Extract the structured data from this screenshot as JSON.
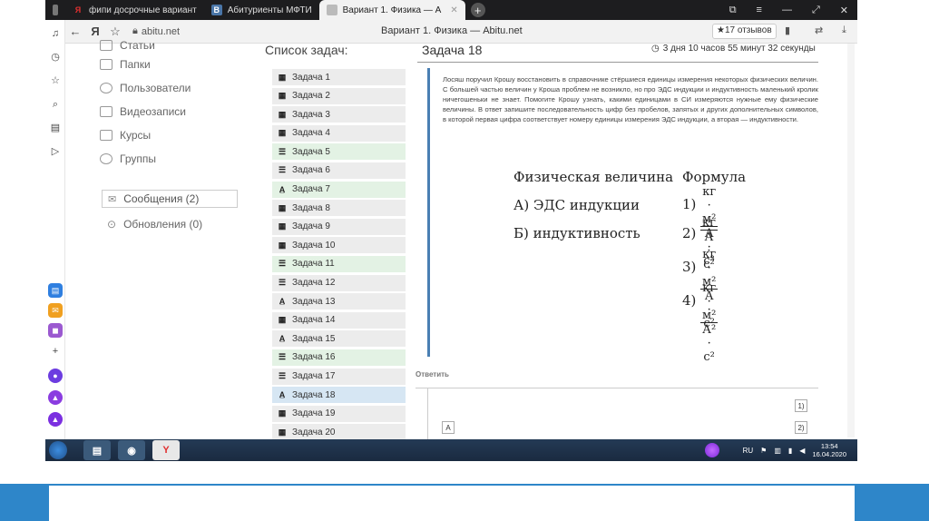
{
  "tabs": [
    {
      "label": "фипи досрочные вариант",
      "icon": "Я",
      "icon_color": "#e03030"
    },
    {
      "label": "Абитуриенты МФТИ",
      "icon": "В",
      "icon_color": "#4a76a8"
    },
    {
      "label": "Вариант 1. Физика — А",
      "icon": "",
      "icon_color": "#888",
      "active": true
    }
  ],
  "address": {
    "url": "abitu.net",
    "page_title": "Вариант 1. Физика — Abitu.net",
    "reviews": "★17 отзывов"
  },
  "menu": {
    "items": [
      {
        "label": "Статьи"
      },
      {
        "label": "Папки"
      },
      {
        "label": "Пользователи"
      },
      {
        "label": "Видеозаписи"
      },
      {
        "label": "Курсы"
      },
      {
        "label": "Группы"
      }
    ],
    "messages": "Сообщения (2)",
    "updates": "Обновления (0)"
  },
  "tasklist": {
    "title": "Список задач:",
    "tasks": [
      {
        "label": "Задача 1",
        "kind": "calc",
        "state": "none"
      },
      {
        "label": "Задача 2",
        "kind": "calc",
        "state": "none"
      },
      {
        "label": "Задача 3",
        "kind": "calc",
        "state": "none"
      },
      {
        "label": "Задача 4",
        "kind": "calc",
        "state": "none"
      },
      {
        "label": "Задача 5",
        "kind": "list",
        "state": "green"
      },
      {
        "label": "Задача 6",
        "kind": "list",
        "state": "none"
      },
      {
        "label": "Задача 7",
        "kind": "text",
        "state": "green"
      },
      {
        "label": "Задача 8",
        "kind": "calc",
        "state": "none"
      },
      {
        "label": "Задача 9",
        "kind": "calc",
        "state": "none"
      },
      {
        "label": "Задача 10",
        "kind": "calc",
        "state": "none"
      },
      {
        "label": "Задача 11",
        "kind": "list",
        "state": "green"
      },
      {
        "label": "Задача 12",
        "kind": "list",
        "state": "none"
      },
      {
        "label": "Задача 13",
        "kind": "text",
        "state": "none"
      },
      {
        "label": "Задача 14",
        "kind": "calc",
        "state": "none"
      },
      {
        "label": "Задача 15",
        "kind": "text",
        "state": "none"
      },
      {
        "label": "Задача 16",
        "kind": "list",
        "state": "green"
      },
      {
        "label": "Задача 17",
        "kind": "list",
        "state": "none"
      },
      {
        "label": "Задача 18",
        "kind": "text",
        "state": "blue"
      },
      {
        "label": "Задача 19",
        "kind": "calc",
        "state": "none"
      },
      {
        "label": "Задача 20",
        "kind": "calc",
        "state": "none"
      }
    ]
  },
  "problem": {
    "title": "Задача 18",
    "timer": "3 дня 10 часов 55 минут 32 секунды",
    "text": "Лосяш поручил Крошу восстановить в справочнике стёршиеся единицы измерения некоторых физических величин. С большей частью величин у Кроша проблем не возникло, но про ЭДС индукции и индуктивность маленький кролик ничегошеньки не знает. Помогите Крошу узнать, какими единицами в СИ измеряются нужные ему физические величины. В ответ запишите последовательность цифр без пробелов, запятых и других дополнительных символов, в которой первая цифра соответствует номеру единицы измерения ЭДС индукции, а вторая — индуктивности.",
    "col_quantity": "Физическая величина",
    "col_formula": "Формула",
    "rows": [
      "А) ЭДС индукции",
      "Б) индуктивность"
    ],
    "formulas": [
      {
        "label": "1)",
        "num": "кг · м²",
        "den": "А · с³"
      },
      {
        "label": "2)",
        "num": "кг",
        "den": "А · с²"
      },
      {
        "label": "3)",
        "num": "кг · м²",
        "den": "А · с²"
      },
      {
        "label": "4)",
        "num": "кг · м²",
        "den": "А² · с²"
      }
    ],
    "answer_label": "Ответить",
    "option_a": "А",
    "option_1": "1)",
    "option_2": "2)"
  },
  "taskbar": {
    "lang": "RU",
    "time": "13:54",
    "date": "16.04.2020"
  }
}
